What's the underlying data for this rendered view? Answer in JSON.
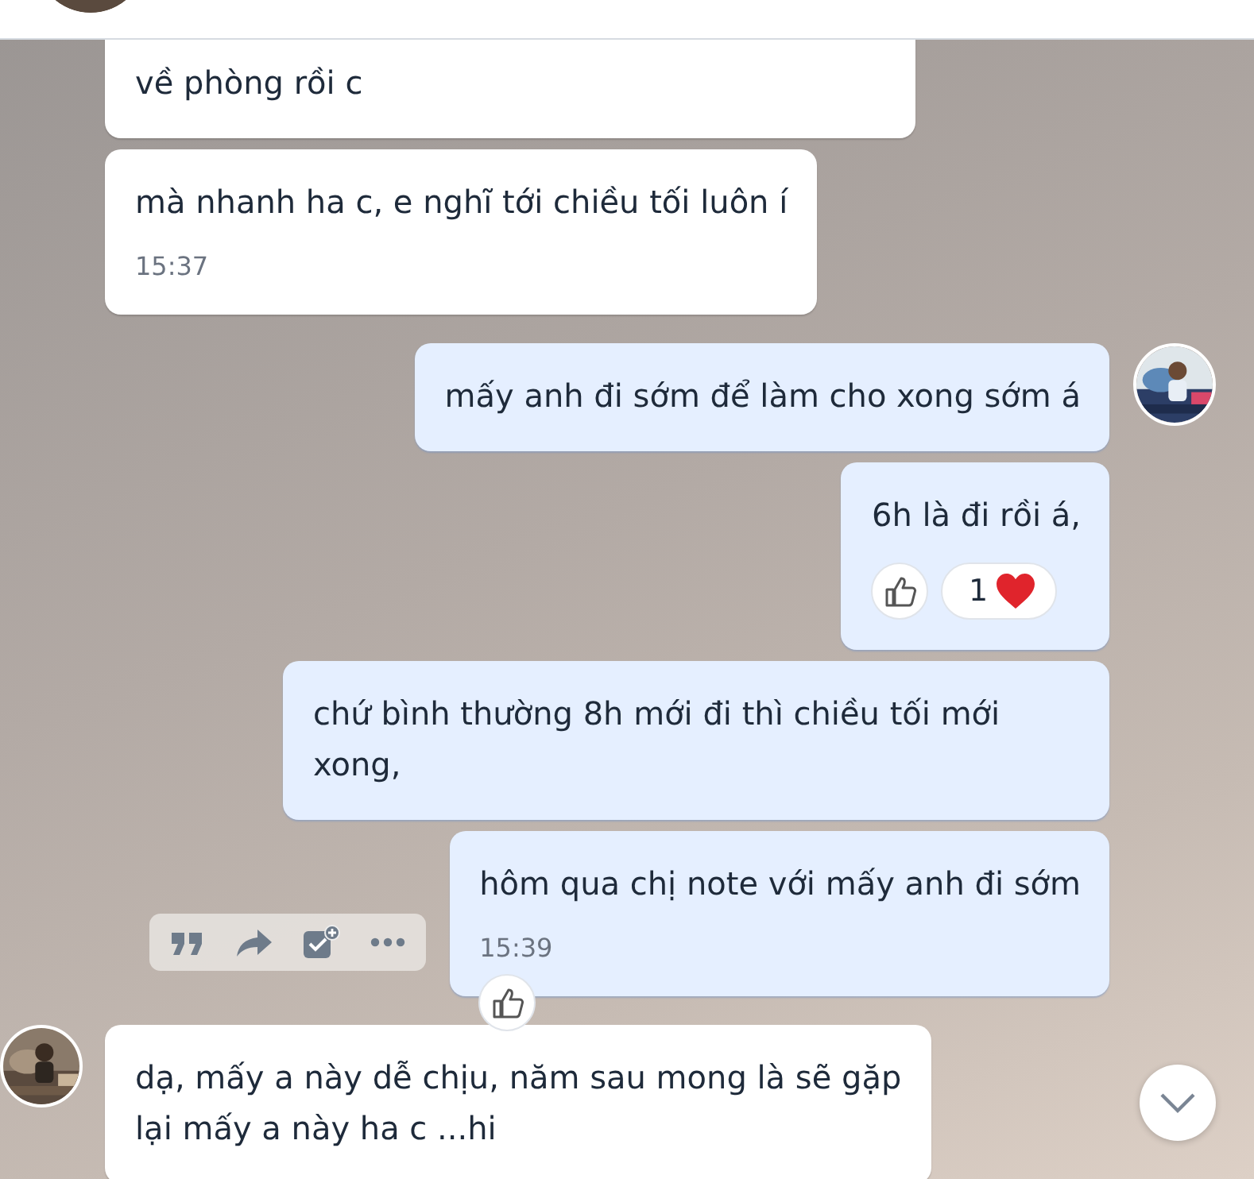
{
  "messages": [
    {
      "kind": "received",
      "text": "về phòng rồi c",
      "cut_off": true,
      "avatar": false
    },
    {
      "kind": "received",
      "text": "mà nhanh ha c, e nghĩ tới chiều tối luôn í",
      "time": "15:37",
      "avatar": false
    },
    {
      "kind": "sent",
      "text": "mấy anh đi sớm để làm cho xong sớm á",
      "avatar": true
    },
    {
      "kind": "sent",
      "text": "6h là đi rồi á,",
      "reaction": {
        "count": "1"
      },
      "avatar": false
    },
    {
      "kind": "sent",
      "text": "chứ bình thường 8h mới đi thì chiều tối mới xong,",
      "avatar": false
    },
    {
      "kind": "sent",
      "text": "hôm qua chị note với mấy anh đi sớm",
      "time": "15:39",
      "hover_toolbar": true,
      "like_below": true,
      "avatar": false
    },
    {
      "kind": "received",
      "text": "dạ, mấy a này dễ chịu, năm sau mong là sẽ gặp lại mấy a này ha c ...hi",
      "avatar": true
    }
  ]
}
